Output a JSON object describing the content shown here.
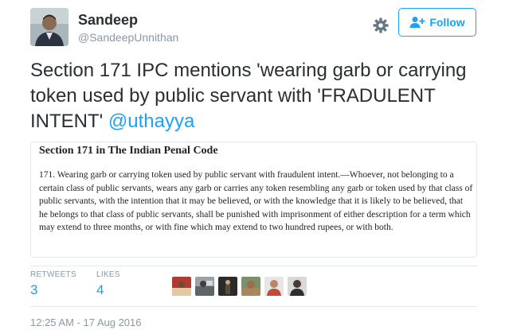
{
  "author": {
    "name": "Sandeep",
    "handle": "@SandeepUnnithan",
    "avatar_icon": "person-avatar"
  },
  "actions": {
    "settings_icon": "gear-icon",
    "follow_label": "Follow",
    "follow_icon": "person-add-icon",
    "accent_color": "#1da1f2"
  },
  "tweet": {
    "text": "Section 171 IPC mentions 'wearing garb or carrying token used by public servant with 'FRADULENT INTENT' ",
    "mention": "@uthayya"
  },
  "attachment": {
    "title": "Section 171 in The Indian Penal Code",
    "body": "171. Wearing garb or carrying token used by public servant with fraudulent intent.—Whoever, not belonging to a certain class of public servants, wears any garb or carries any token resembling any garb or token used by that class of public servants, with the intention that it may be believed, or with the knowledge that it is likely to be believed, that he belongs to that class of public servants, shall be punished with imprisonment of either description for a term which may extend to three months, or with fine which may extend to two hundred rupees, or with both."
  },
  "stats": {
    "retweets_label": "RETWEETS",
    "retweets_count": "3",
    "likes_label": "LIKES",
    "likes_count": "4"
  },
  "likers": [
    {
      "icon": "liker-avatar-1"
    },
    {
      "icon": "liker-avatar-2"
    },
    {
      "icon": "liker-avatar-3"
    },
    {
      "icon": "liker-avatar-4"
    },
    {
      "icon": "liker-avatar-5"
    },
    {
      "icon": "liker-avatar-6"
    }
  ],
  "timestamp": "12:25 AM - 17 Aug 2016"
}
